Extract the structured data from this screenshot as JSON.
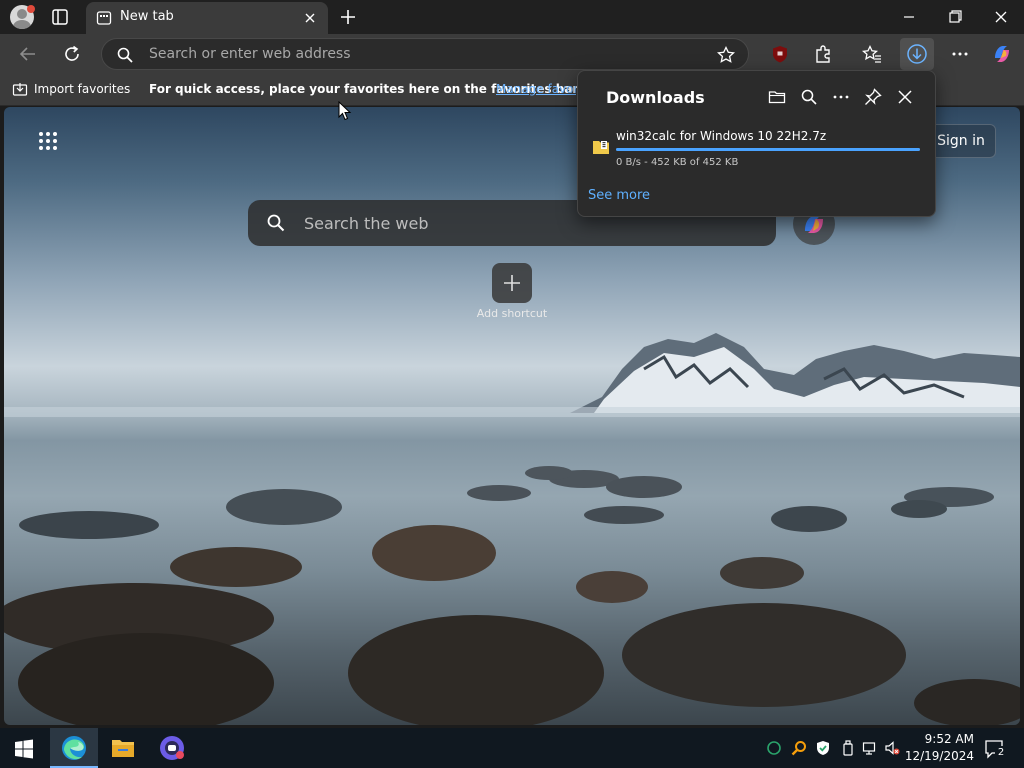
{
  "browser": {
    "tab": {
      "title": "New tab"
    },
    "address_bar": {
      "placeholder": "Search or enter web address"
    },
    "favorites_bar": {
      "import_label": "Import favorites",
      "hint": "For quick access, place your favorites here on the favorites bar.",
      "manage_link": "Manage favorites now"
    }
  },
  "downloads_panel": {
    "title": "Downloads",
    "item": {
      "filename": "win32calc for Windows 10 22H2.7z",
      "status": "0 B/s - 452 KB of 452 KB",
      "progress": 1.0
    },
    "see_more": "See more"
  },
  "new_tab_page": {
    "search_placeholder": "Search the web",
    "sign_in_label": "Sign in",
    "add_shortcut_label": "Add shortcut"
  },
  "taskbar": {
    "time": "9:52 AM",
    "date": "12/19/2024",
    "notification_count": "2"
  },
  "colors": {
    "accent": "#4aa3ff",
    "link": "#6cb4ff",
    "titlebar": "#202020",
    "toolbar": "#3b3b3b",
    "taskbar": "#101820"
  },
  "icons": [
    "profile-icon",
    "tab-actions-icon",
    "newtab-page-icon",
    "close-icon",
    "plus-icon",
    "minimize-icon",
    "restore-icon",
    "back-arrow-icon",
    "refresh-icon",
    "search-icon",
    "star-add-icon",
    "ublock-icon",
    "extensions-icon",
    "favorites-icon",
    "download-icon",
    "more-icon",
    "copilot-icon",
    "folder-icon",
    "pin-icon",
    "zip-file-icon",
    "apps-grid-icon",
    "windows-start-icon",
    "edge-icon",
    "file-explorer-icon",
    "app-icon",
    "notification-icon"
  ]
}
